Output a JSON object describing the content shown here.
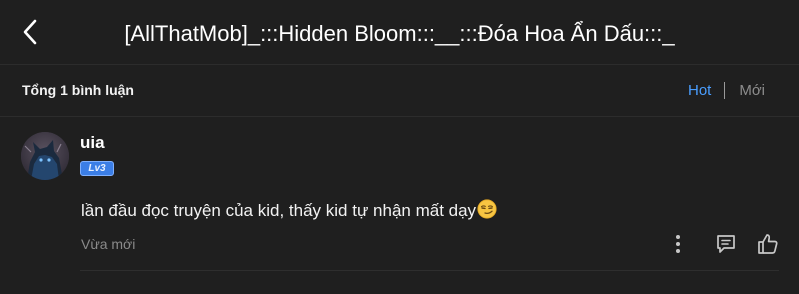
{
  "header": {
    "title": "[AllThatMob]_:::Hidden Bloom:::__:::Đóa Hoa Ẩn Dấu:::_",
    "back_icon": "chevron-left-icon"
  },
  "comments_bar": {
    "total_label": "Tổng 1 bình luận",
    "sort_hot_label": "Hot",
    "sort_new_label": "Mới",
    "active_sort": "Hot"
  },
  "comment": {
    "username": "uia",
    "level_badge": "Lv3",
    "text": "lần đầu đọc truyện của kid, thấy kid tự nhận mất dạy",
    "emoji_icon": "smirking-face-icon",
    "timestamp": "Vừa mới",
    "actions": {
      "more_icon": "more-vertical-icon",
      "reply_icon": "reply-comment-icon",
      "like_icon": "thumbs-up-icon"
    }
  },
  "colors": {
    "background": "#1f1f1f",
    "accent": "#4a9eff",
    "badge": "#3b7ee6",
    "muted": "#8a8a8a"
  }
}
